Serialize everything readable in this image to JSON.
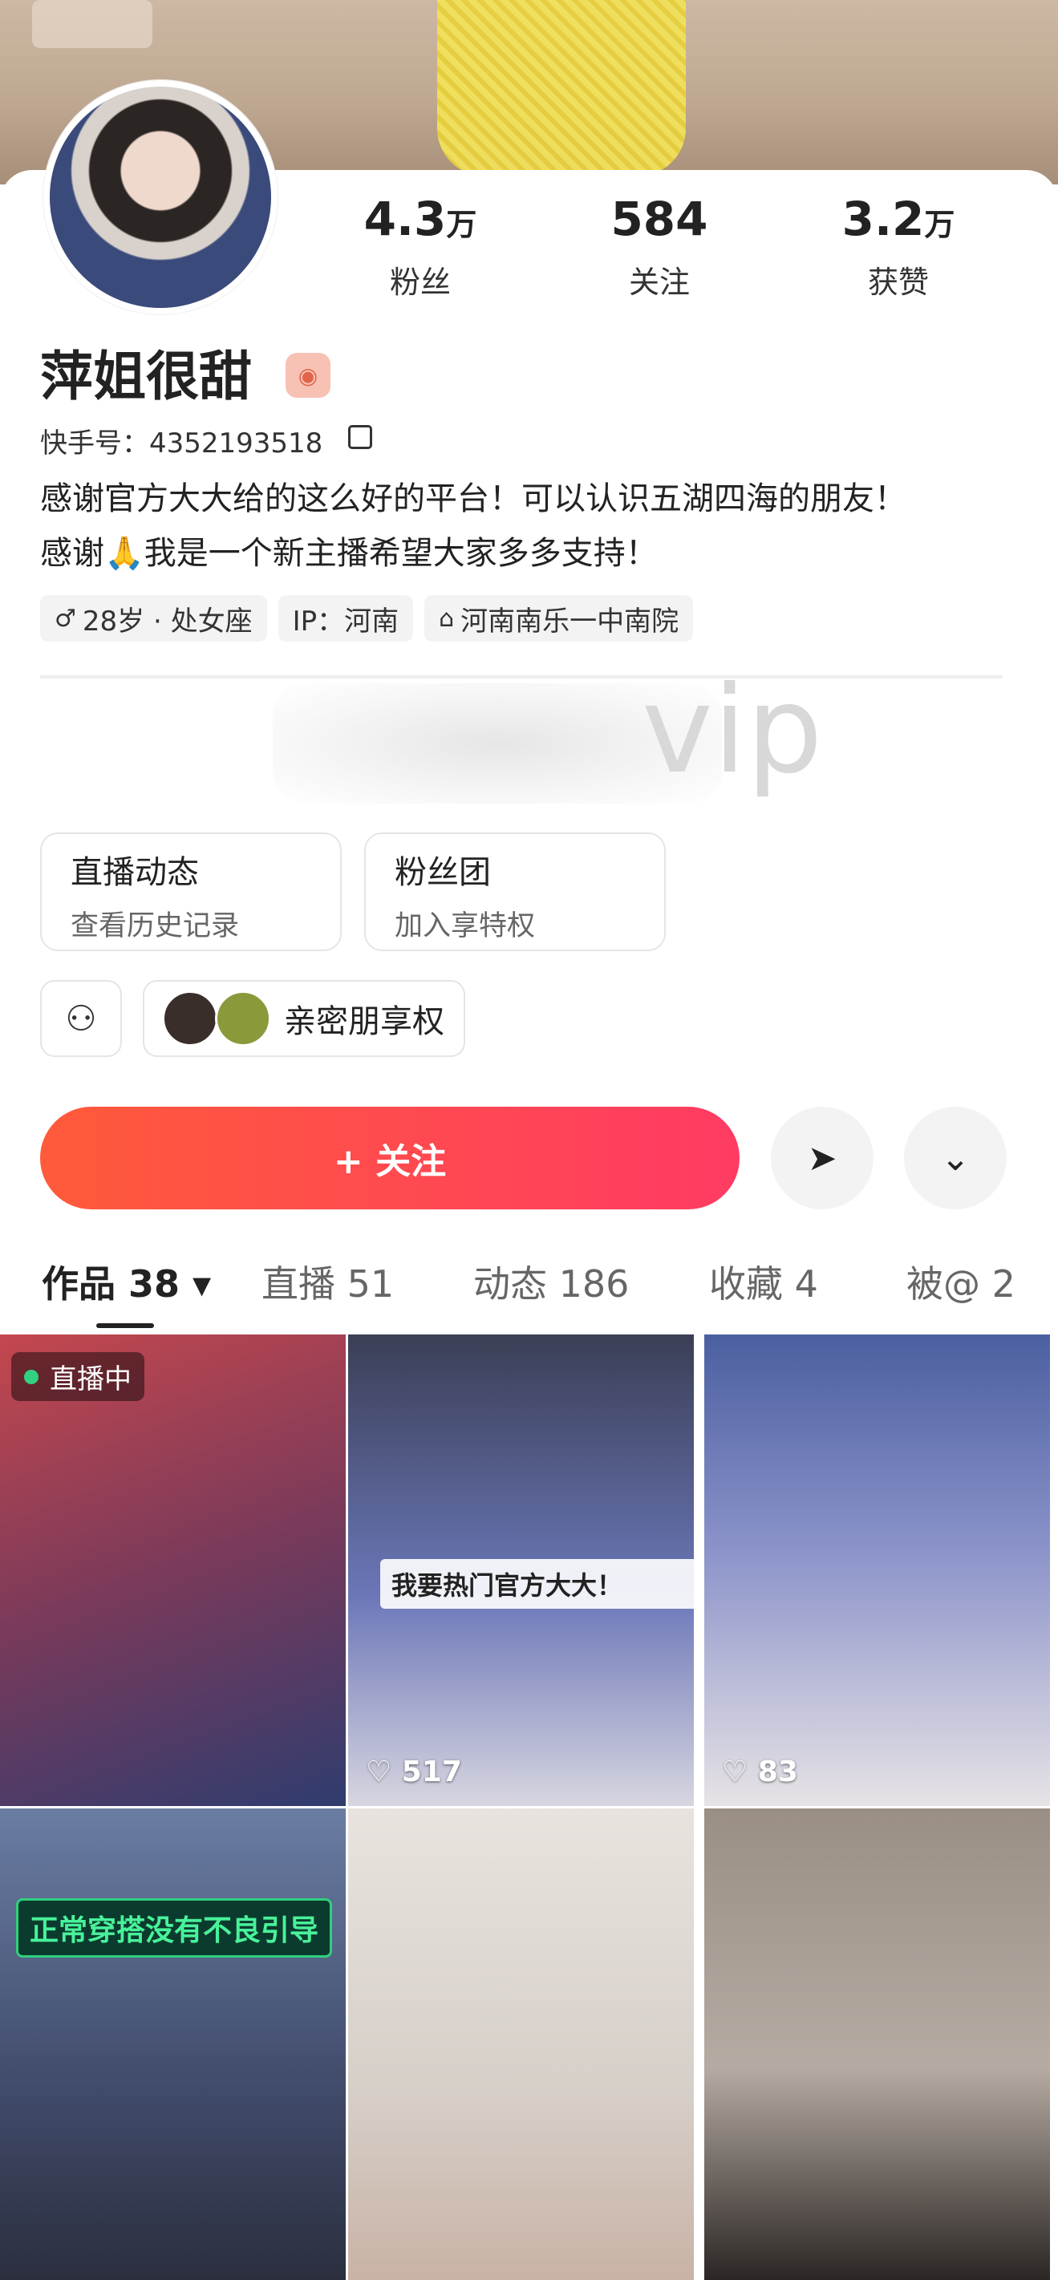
{
  "profile": {
    "name": "萍姐很甜",
    "kuaishou_id": "快手号：4352193518",
    "bio_line1": "感谢官方大大给的这么好的平台！可以认识五湖四海的朋友！",
    "bio_line2": "感谢🙏我是一个新主播希望大家多多支持！",
    "tags": [
      {
        "icon": "♂",
        "text": "28岁 · 处女座"
      },
      {
        "icon": "",
        "text": "IP：河南"
      },
      {
        "icon": "⌂",
        "text": "河南南乐一中南院"
      }
    ],
    "watermark": "vip"
  },
  "stats": [
    {
      "num": "4.3",
      "unit": "万",
      "label": "粉丝"
    },
    {
      "num": "584",
      "unit": "",
      "label": "关注"
    },
    {
      "num": "3.2",
      "unit": "万",
      "label": "获赞"
    }
  ],
  "entries": [
    {
      "title": "直播动态",
      "sub": "查看历史记录"
    },
    {
      "title": "粉丝团",
      "sub": "加入享特权"
    }
  ],
  "friends_text": "亲密朋享权",
  "follow_label": "+ 关注",
  "tabs": [
    {
      "label": "作品 38 ▾",
      "active": true
    },
    {
      "label": "直播 51",
      "active": false
    },
    {
      "label": "动态 186",
      "active": false
    },
    {
      "label": "收藏 4",
      "active": false
    },
    {
      "label": "被@ 2",
      "active": false
    }
  ],
  "grid": [
    {
      "live": "直播中",
      "likes": "",
      "caption": ""
    },
    {
      "live": "",
      "likes": "♡ 517",
      "caption": "我要热门官方大大！"
    },
    {
      "live": "",
      "likes": "♡ 83",
      "caption": ""
    },
    {
      "live": "",
      "likes": "",
      "caption": "正常穿搭没有不良引导"
    },
    {
      "live": "",
      "likes": "",
      "caption": ""
    },
    {
      "live": "",
      "likes": "",
      "caption": ""
    }
  ],
  "colors": {
    "accent_start": "#ff5a3a",
    "accent_end": "#ff3b63",
    "live_dot": "#31d181"
  }
}
